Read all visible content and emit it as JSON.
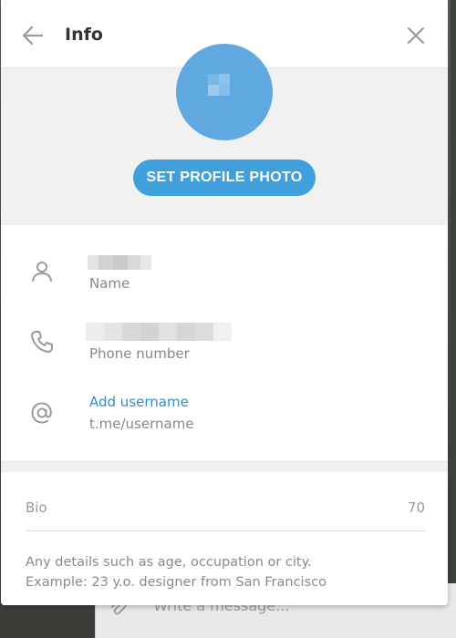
{
  "dialog": {
    "title": "Info"
  },
  "profile": {
    "set_photo_label": "SET PROFILE PHOTO",
    "avatar_color": "#60a8e0",
    "button_color": "#3fa0dc"
  },
  "rows": [
    {
      "icon": "person-icon",
      "value": "[redacted]",
      "label": "Name"
    },
    {
      "icon": "phone-icon",
      "value": "[redacted]",
      "label": "Phone number"
    },
    {
      "icon": "at-icon",
      "link": "Add username",
      "label": "t.me/username"
    }
  ],
  "bio": {
    "placeholder": "Bio",
    "counter": "70",
    "help_line1": "Any details such as age, occupation or city.",
    "help_line2": "Example: 23 y.o. designer from San Francisco"
  },
  "background": {
    "compose_placeholder": "Write a message..."
  },
  "colors": {
    "link": "#2a8fd3",
    "muted_text": "#888888"
  }
}
